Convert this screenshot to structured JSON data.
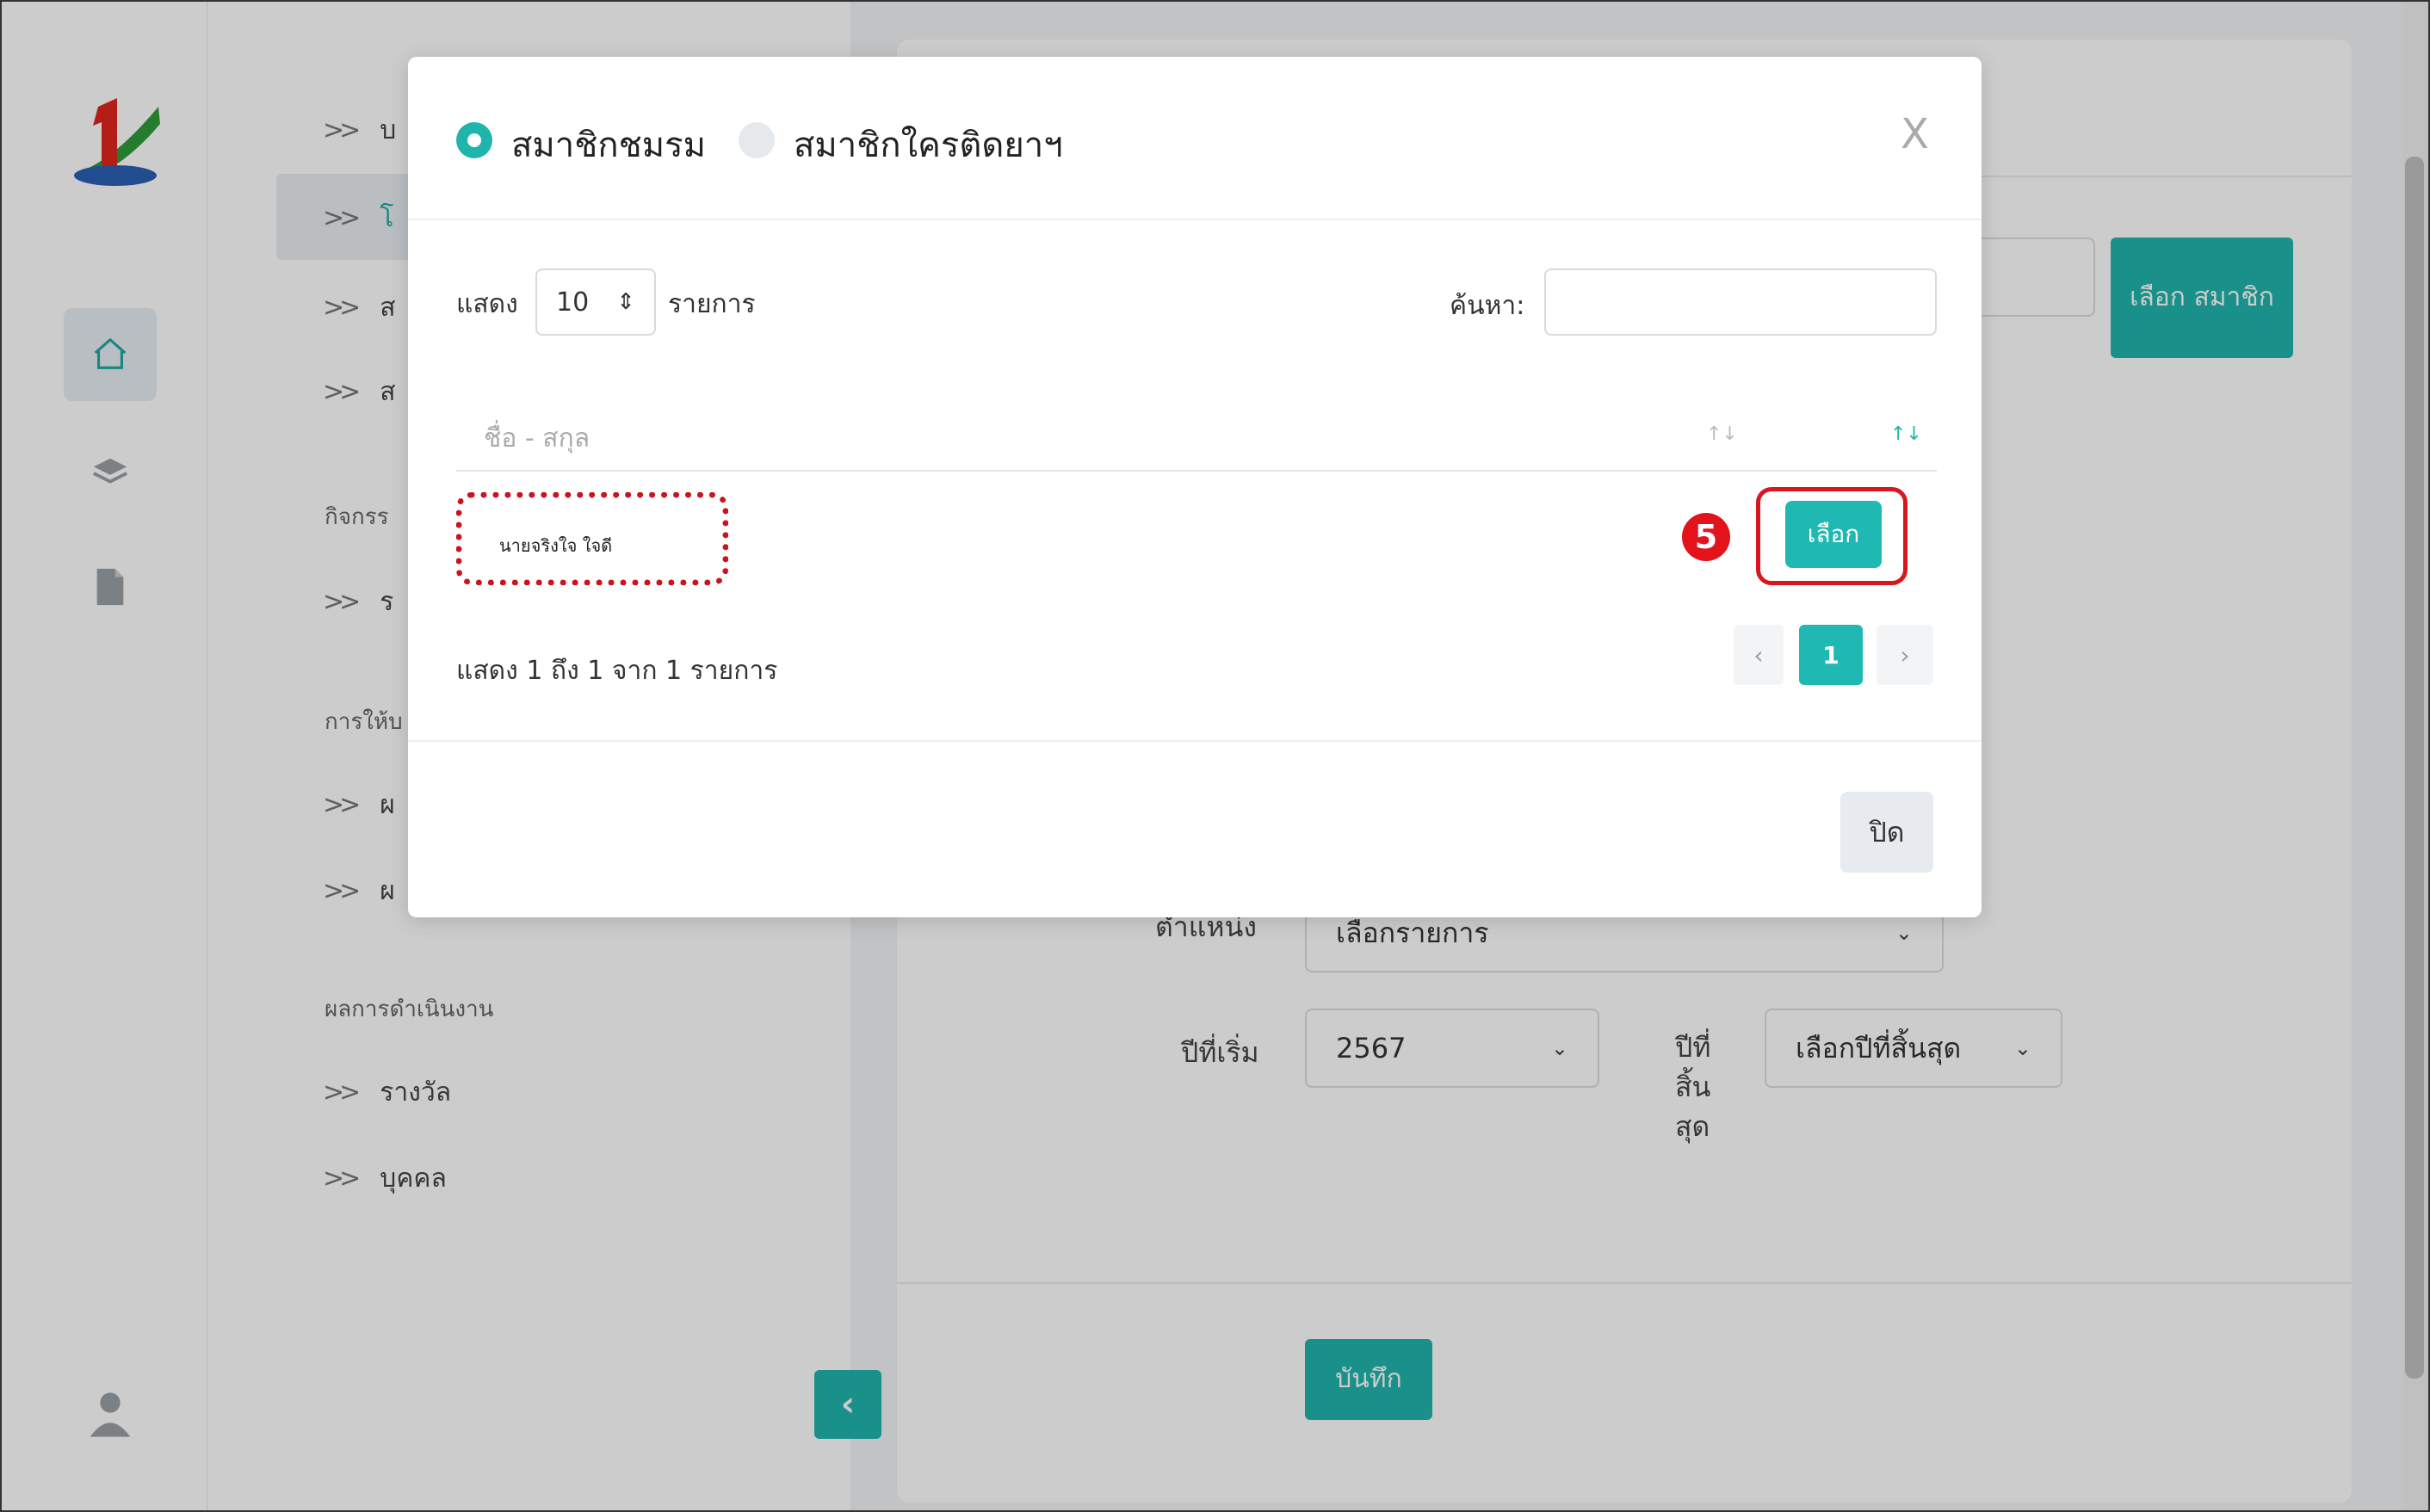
{
  "sidebar": {
    "menu": {
      "items_top": [
        {
          "label": "บ"
        },
        {
          "label": "โ"
        },
        {
          "label": "ส"
        },
        {
          "label": "ส"
        }
      ],
      "section_activity": "กิจกรร",
      "item_activity": "ร",
      "section_service": "การให้บ",
      "items_service": [
        {
          "label": "ผ"
        },
        {
          "label": "ผ"
        }
      ],
      "section_results": "ผลการดำเนินงาน",
      "items_results": [
        {
          "label": "รางวัล"
        },
        {
          "label": "บุคคล"
        }
      ]
    }
  },
  "content": {
    "select_member_button": "เลือก สมาชิก",
    "position_label": "ตำแหน่ง",
    "position_select": "เลือกรายการ",
    "start_year_label": "ปีที่เริ่ม",
    "start_year_value": "2567",
    "end_year_label": "ปีที่ สิ้น สุด",
    "end_year_select": "เลือกปีที่สิ้นสุด",
    "save_button": "บันทึก",
    "collapse_button": "‹"
  },
  "modal": {
    "radio_options": [
      {
        "label": "สมาชิกชมรม",
        "checked": true
      },
      {
        "label": "สมาชิกใครติดยาฯ",
        "checked": false
      }
    ],
    "close_x": "X",
    "length_prefix": "แสดง",
    "length_value": "10",
    "length_suffix": "รายการ",
    "search_label": "ค้นหา:",
    "search_value": "",
    "column_header": "ชื่อ - สกุล",
    "rows": [
      {
        "name": "นายจริงใจ ใจดี",
        "action": "เลือก"
      }
    ],
    "step_badge": "5",
    "info_text": "แสดง 1 ถึง 1 จาก 1 รายการ",
    "pagination": {
      "prev": "‹",
      "current": "1",
      "next": "›"
    },
    "close_button": "ปิด"
  },
  "colors": {
    "accent": "#20b5ac",
    "highlight_red": "#d8161e"
  }
}
